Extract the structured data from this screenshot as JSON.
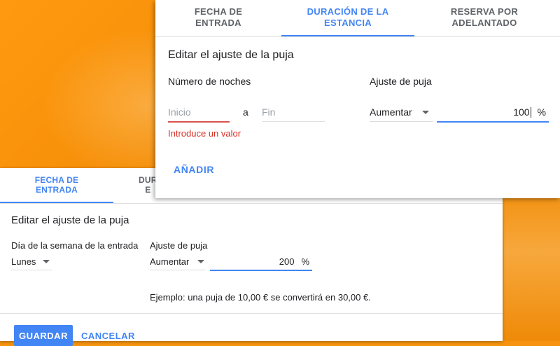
{
  "back_card": {
    "tabs": [
      {
        "label": "FECHA DE\nENTRADA"
      },
      {
        "label": "DUR\nE"
      }
    ],
    "title": "Editar el ajuste de la puja",
    "day_label": "Día de la semana de la entrada",
    "day_value": "Lunes",
    "bid_label": "Ajuste de puja",
    "bid_mode": "Aumentar",
    "bid_value": "200",
    "bid_unit": "%",
    "example": "Ejemplo: una puja de 10,00 € se convertirá en 30,00 €.",
    "save_label": "GUARDAR",
    "cancel_label": "CANCELAR"
  },
  "front_card": {
    "tabs": [
      {
        "label": "FECHA DE\nENTRADA"
      },
      {
        "label": "DURACIÓN DE LA\nESTANCIA"
      },
      {
        "label": "RESERVA POR\nADELANTADO"
      }
    ],
    "title": "Editar el ajuste de la puja",
    "nights_label": "Número de noches",
    "start_placeholder": "Inicio",
    "separator": "a",
    "end_placeholder": "Fin",
    "error_text": "Introduce un valor",
    "bid_label": "Ajuste de puja",
    "bid_mode": "Aumentar",
    "bid_value": "100",
    "bid_unit": "%",
    "add_label": "AÑADIR"
  },
  "colors": {
    "accent": "#4285f4",
    "error": "#d93025",
    "background": "#f5930f"
  },
  "icons": [
    "chevron-down-icon"
  ]
}
